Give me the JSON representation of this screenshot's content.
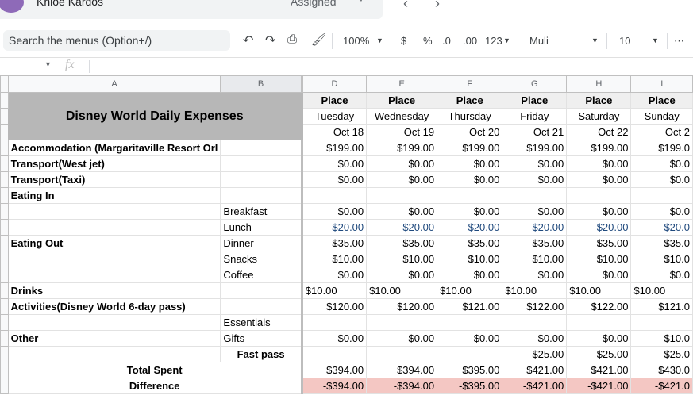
{
  "user": {
    "name": "Khloe Kardos",
    "status": "Assigned"
  },
  "menu_search": {
    "placeholder": "Search the menus (Option+/)"
  },
  "toolbar": {
    "zoom": "100%",
    "currency": "$",
    "percent": "%",
    "dec_decrease": ".0",
    "dec_increase": ".00",
    "format": "123",
    "font": "Muli",
    "font_size": "10",
    "more": "⋯"
  },
  "formula_bar": {
    "fx": "fx",
    "value": ""
  },
  "columns": [
    "A",
    "B",
    "D",
    "E",
    "F",
    "G",
    "H",
    "I"
  ],
  "sheet": {
    "title": "Disney World Daily Expenses",
    "place_label": "Place",
    "days": [
      "Tuesday",
      "Wednesday",
      "Thursday",
      "Friday",
      "Saturday",
      "Sunday"
    ],
    "dates": [
      "Oct 18",
      "Oct 19",
      "Oct 20",
      "Oct 21",
      "Oct 22",
      "Oct 2"
    ],
    "rows": [
      {
        "a": "Accommodation (Margaritaville Resort Orl",
        "b": "",
        "vals": [
          "$199.00",
          "$199.00",
          "$199.00",
          "$199.00",
          "$199.00",
          "$199.0"
        ]
      },
      {
        "a": "Transport(West jet)",
        "b": "",
        "vals": [
          "$0.00",
          "$0.00",
          "$0.00",
          "$0.00",
          "$0.00",
          "$0.0"
        ]
      },
      {
        "a": "Transport(Taxi)",
        "b": "",
        "vals": [
          "$0.00",
          "$0.00",
          "$0.00",
          "$0.00",
          "$0.00",
          "$0.0"
        ]
      },
      {
        "a": "Eating In",
        "b": "",
        "vals": [
          "",
          "",
          "",
          "",
          "",
          ""
        ]
      },
      {
        "a": "",
        "b": "Breakfast",
        "vals": [
          "$0.00",
          "$0.00",
          "$0.00",
          "$0.00",
          "$0.00",
          "$0.0"
        ]
      },
      {
        "a": "",
        "b": "Lunch",
        "vals": [
          "$20.00",
          "$20.00",
          "$20.00",
          "$20.00",
          "$20.00",
          "$20.0"
        ]
      },
      {
        "a": "Eating Out",
        "b": "Dinner",
        "vals": [
          "$35.00",
          "$35.00",
          "$35.00",
          "$35.00",
          "$35.00",
          "$35.0"
        ]
      },
      {
        "a": "",
        "b": "Snacks",
        "vals": [
          "$10.00",
          "$10.00",
          "$10.00",
          "$10.00",
          "$10.00",
          "$10.0"
        ]
      },
      {
        "a": "",
        "b": "Coffee",
        "vals": [
          "$0.00",
          "$0.00",
          "$0.00",
          "$0.00",
          "$0.00",
          "$0.0"
        ]
      },
      {
        "a": "Drinks",
        "b": "",
        "vals": [
          "$10.00",
          "$10.00",
          "$10.00",
          "$10.00",
          "$10.00",
          "$10.00"
        ]
      },
      {
        "a": "Activities(Disney World 6-day pass)",
        "b": "",
        "vals": [
          "$120.00",
          "$120.00",
          "$121.00",
          "$122.00",
          "$122.00",
          "$121.0"
        ]
      },
      {
        "a": "",
        "b": "Essentials",
        "vals": [
          "",
          "",
          "",
          "",
          "",
          ""
        ]
      },
      {
        "a": "Other",
        "b": "Gifts",
        "vals": [
          "$0.00",
          "$0.00",
          "$0.00",
          "$0.00",
          "$0.00",
          "$10.0"
        ]
      },
      {
        "a": "",
        "b": "Fast pass",
        "vals": [
          "",
          "",
          "",
          "$25.00",
          "$25.00",
          "$25.0"
        ]
      },
      {
        "a": "Total Spent",
        "b": "",
        "vals": [
          "$394.00",
          "$394.00",
          "$395.00",
          "$421.00",
          "$421.00",
          "$430.0"
        ]
      },
      {
        "a": "Difference",
        "b": "",
        "vals": [
          "-$394.00",
          "-$394.00",
          "-$395.00",
          "-$421.00",
          "-$421.00",
          "-$421.0"
        ]
      }
    ]
  },
  "colors": {
    "header_gray": "#b7b7b7",
    "difference_red": "#f4c7c3",
    "lunch_blue": "#1f497d"
  }
}
